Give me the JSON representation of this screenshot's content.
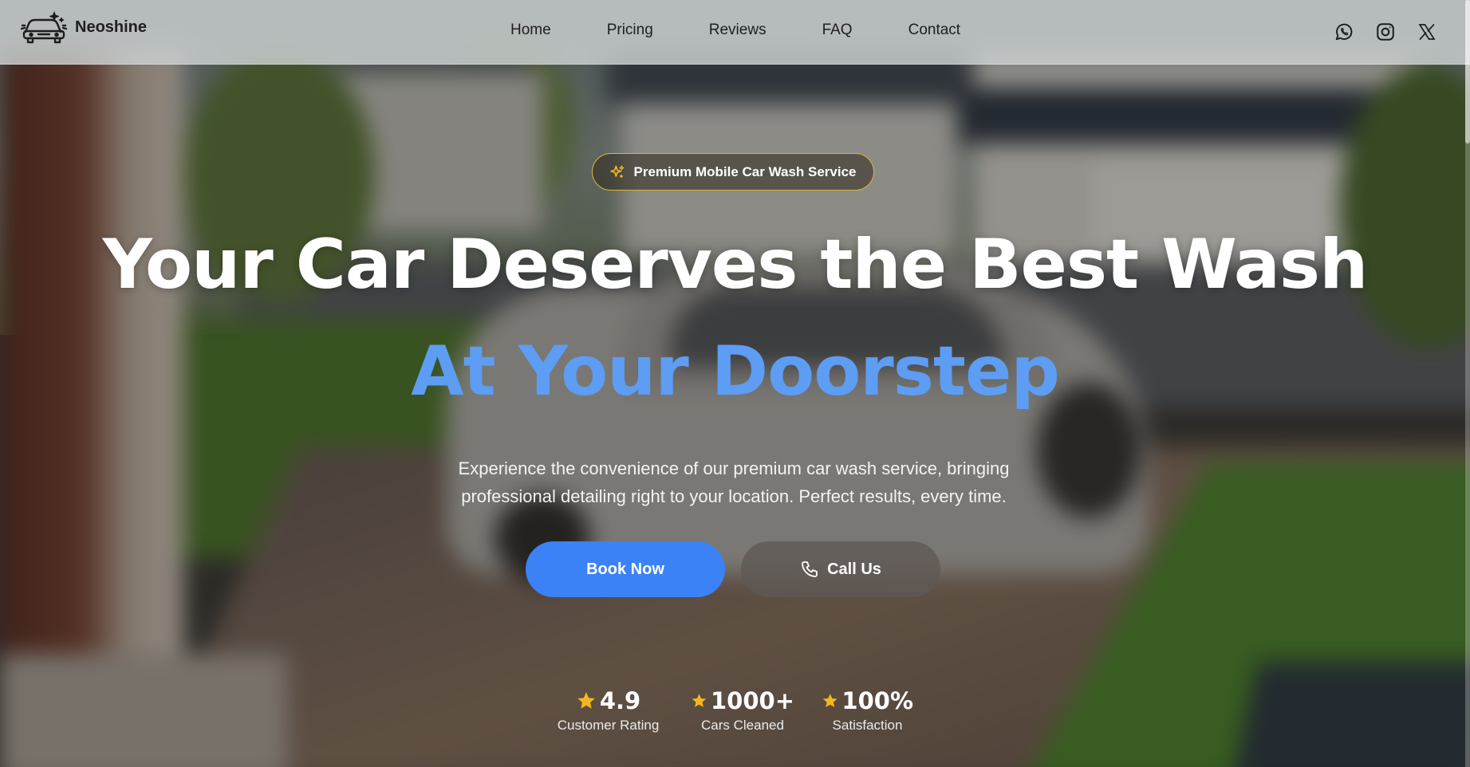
{
  "header": {
    "brand": {
      "name": "Neoshine",
      "logo_icon": "car-sparkle-icon"
    },
    "nav": [
      {
        "label": "Home"
      },
      {
        "label": "Pricing"
      },
      {
        "label": "Reviews"
      },
      {
        "label": "FAQ"
      },
      {
        "label": "Contact"
      }
    ],
    "socials": [
      {
        "name": "whatsapp-icon"
      },
      {
        "name": "instagram-icon"
      },
      {
        "name": "x-icon"
      }
    ]
  },
  "hero": {
    "badge": {
      "icon": "sparkles-icon",
      "label": "Premium Mobile Car Wash Service"
    },
    "title_line1": "Your Car Deserves the Best Wash",
    "title_line2": "At Your Doorstep",
    "description": "Experience the convenience of our premium car wash service, bringing professional detailing right to your location. Perfect results, every time.",
    "buttons": {
      "book": "Book Now",
      "call": "Call Us"
    },
    "stats": [
      {
        "value": "4.9",
        "label": "Customer Rating"
      },
      {
        "value": "1000+",
        "label": "Cars Cleaned"
      },
      {
        "value": "100%",
        "label": "Satisfaction"
      }
    ]
  },
  "colors": {
    "accent": "#3b82f6",
    "accent_light": "#5d9df3",
    "badge_border": "#e2b43a",
    "star": "#f5b81c"
  }
}
